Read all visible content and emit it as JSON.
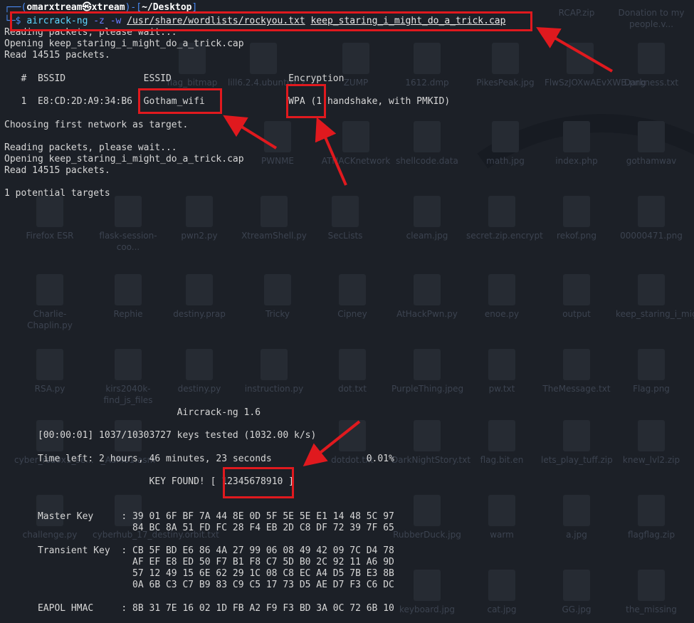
{
  "desktop": {
    "icons": [
      "RCAP.zip",
      "Donation to my people.v...",
      "flag_bitmap",
      "lill6.2.4.ubuntu1.2",
      "ZUMP",
      "1612.dmp",
      "PikesPeak.jpg",
      "FlwSzJOXwAEvXWB.png",
      "Darkness.txt",
      "PWNME",
      "ATHACKnetwork",
      "shellcode.data",
      "math.jpg",
      "index.php",
      "gothamwav",
      "Firefox ESR",
      "flask-session-coo...",
      "pwn2.py",
      "XtreamShell.py",
      "SecLists",
      "cleam.jpg",
      "secret.zip.encrypt",
      "rekof.png",
      "00000471.png",
      "Charlie-Chaplin.py",
      "Rephie",
      "destiny.prap",
      "Tricky",
      "Cipney",
      "AtHackPwn.py",
      "enoe.py",
      "output",
      "keep_staring_i_might_d...",
      "RSA.py",
      "kirs2040k-find_js_files",
      "destiny.py",
      "instruction.py",
      "dot.txt",
      "PurpleThing.jpeg",
      "pw.txt",
      "TheMessage.txt",
      "Flag.png",
      "cyber_rsa0x1_se...",
      "_ASM01.asm",
      "dotdot.txt",
      "DarkNightStory.txt",
      "flag.bit.en",
      "lets_play_tuff.zip",
      "knew_lvl2.zip",
      "challenge.py",
      "cyberhub_17_destiny.orbit.txt",
      "RubberDuck.jpg",
      "warm",
      "a.jpg",
      "flagflag.zip",
      "keyboard.jpg",
      "cat.jpg",
      "GG.jpg",
      "the_missing"
    ]
  },
  "terminal": {
    "prompt_user": "omarxtream",
    "prompt_at": "㉿",
    "prompt_host": "xtream",
    "prompt_dir": "~/Desktop",
    "cmd_name": "aircrack-ng",
    "cmd_flags": "-z -w",
    "cmd_wordlist": "/usr/share/wordlists/rockyou.txt",
    "cmd_capfile": "keep_staring_i_might_do_a_trick.cap",
    "lines": {
      "l1": "Reading packets, please wait...",
      "l2": "Opening keep_staring_i_might_do_a_trick.cap",
      "l3": "Read 14515 packets.",
      "header": "   #  BSSID              ESSID                     Encryption",
      "row_num": "   1  E8:CD:2D:A9:34:B6  ",
      "essid": "Gotham_wifi",
      "enc_pad": "               ",
      "enc": "WPA (1 handshake, with PMKID)",
      "choose": "Choosing first network as target.",
      "l4": "Reading packets, please wait...",
      "l5": "Opening keep_staring_i_might_do_a_trick.cap",
      "l6": "Read 14515 packets.",
      "targets": "1 potential targets",
      "banner": "                               Aircrack-ng 1.6",
      "tested": "      [00:00:01] 1037/10303727 keys tested (1032.00 k/s)",
      "timeleft": "      Time left: 2 hours, 46 minutes, 23 seconds                 0.01%",
      "keyfound_pre": "                          KEY FOUND! [ ",
      "key": "12345678910",
      "keyfound_post": " ]",
      "mk1": "      Master Key     : 39 01 6F BF 7A 44 8E 0D 5F 5E 5E E1 14 48 5C 97",
      "mk2": "                       84 BC 8A 51 FD FC 28 F4 EB 2D C8 DF 72 39 7F 65",
      "tk1": "      Transient Key  : CB 5F BD E6 86 4A 27 99 06 08 49 42 09 7C D4 78",
      "tk2": "                       AF EF E8 ED 50 F7 B1 F8 C7 5D B0 2C 92 11 A6 9D",
      "tk3": "                       57 12 49 15 6E 62 29 1C 08 C8 EC A4 D5 7B E3 8B",
      "tk4": "                       0A 6B C3 C7 B9 83 C9 C5 17 73 D5 AE D7 F3 C6 DC",
      "hmac": "      EAPOL HMAC     : 8B 31 7E 16 02 1D FB A2 F9 F3 BD 3A 0C 72 6B 10"
    }
  },
  "colors": {
    "annotation": "#e0191e",
    "background": "#1c2027",
    "text": "#d7d7d7"
  }
}
